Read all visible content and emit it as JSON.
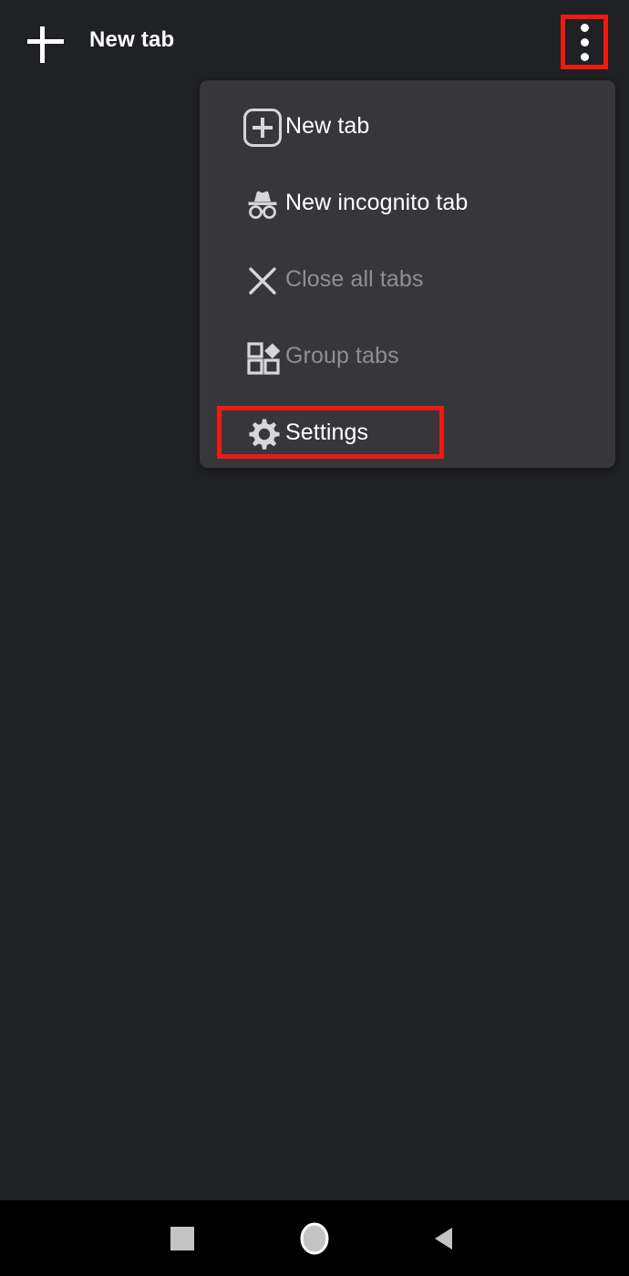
{
  "app": {
    "background_color": "#202124",
    "menu_background_color": "#37373b",
    "highlight_color": "#ee1b11",
    "text_color": "#ffffff",
    "disabled_text_color": "#8f8f93"
  },
  "topbar": {
    "new_tab_button_icon": "plus-icon",
    "title": "New tab",
    "overflow_button_icon": "three-dot-menu-icon",
    "overflow_highlighted": true
  },
  "menu": {
    "items": [
      {
        "label": "New tab",
        "icon": "new-tab-icon",
        "enabled": true,
        "highlighted": false
      },
      {
        "label": "New incognito tab",
        "icon": "incognito-icon",
        "enabled": true,
        "highlighted": false
      },
      {
        "label": "Close all tabs",
        "icon": "close-x-icon",
        "enabled": false,
        "highlighted": false
      },
      {
        "label": "Group tabs",
        "icon": "group-tabs-icon",
        "enabled": false,
        "highlighted": false
      },
      {
        "label": "Settings",
        "icon": "gear-icon",
        "enabled": true,
        "highlighted": true
      }
    ]
  },
  "navbar": {
    "recent_label": "recent-apps-icon",
    "home_label": "home-icon",
    "back_label": "back-icon"
  }
}
